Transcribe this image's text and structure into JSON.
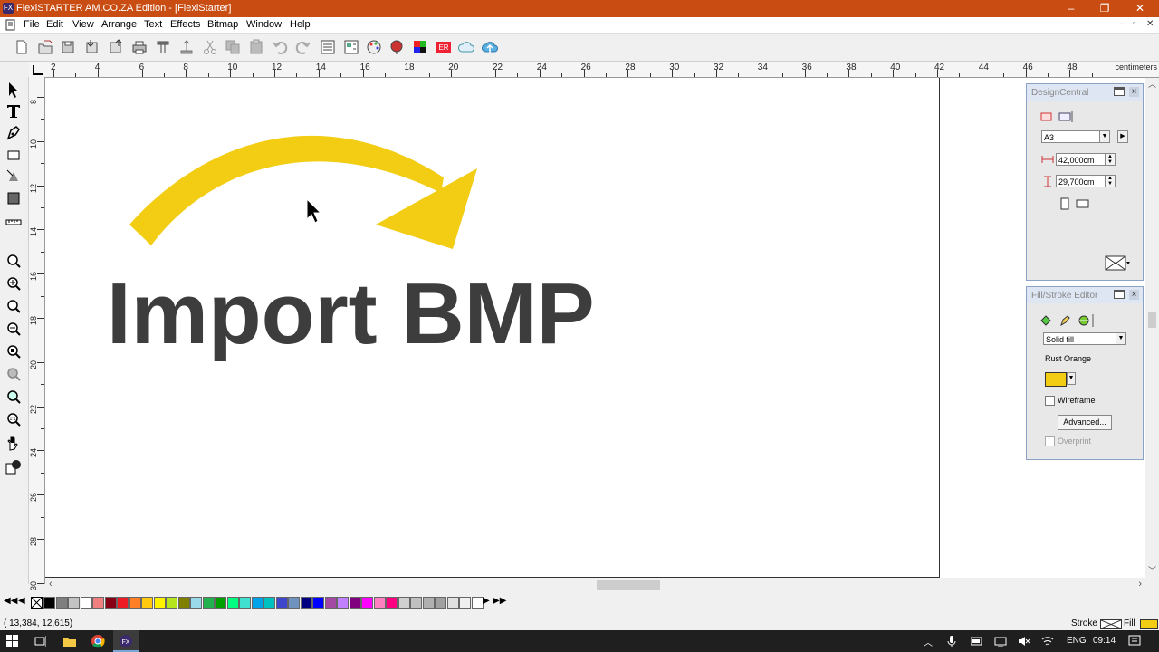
{
  "window": {
    "title": "FlexiSTARTER AM.CO.ZA Edition - [FlexiStarter]",
    "minimize": "–",
    "restore": "❐",
    "close": "✕"
  },
  "menu": [
    "File",
    "Edit",
    "View",
    "Arrange",
    "Text",
    "Effects",
    "Bitmap",
    "Window",
    "Help"
  ],
  "mdi_controls": [
    "–",
    "▫",
    "✕"
  ],
  "ruler": {
    "unit": "centimeters",
    "h_labels": [
      "2",
      "4",
      "6",
      "8",
      "10",
      "12",
      "14",
      "16",
      "18",
      "20",
      "22",
      "24",
      "26",
      "28",
      "30",
      "32",
      "34",
      "36",
      "38",
      "40",
      "42",
      "44",
      "46",
      "48"
    ],
    "v_labels": [
      "8",
      "10",
      "12",
      "14",
      "16",
      "18",
      "20",
      "22",
      "24",
      "26",
      "28",
      "30"
    ]
  },
  "canvas": {
    "text": "Import BMP",
    "arrow_color": "#f2cd13",
    "text_color": "#3d3d3d"
  },
  "design_central": {
    "title": "DesignCentral",
    "page_size": "A3",
    "width": "42,000cm",
    "height": "29,700cm"
  },
  "fill_stroke": {
    "title": "Fill/Stroke Editor",
    "fill_type": "Solid fill",
    "color_name": "Rust Orange",
    "swatch_color": "#f2cd13",
    "wireframe": "Wireframe",
    "advanced": "Advanced...",
    "overprint": "Overprint"
  },
  "palette_colors": [
    "#000000",
    "#7f7f7f",
    "#c3c3c3",
    "#ffffff",
    "#f08080",
    "#880015",
    "#ed1c24",
    "#ff7f27",
    "#ffc90e",
    "#fff200",
    "#b5e61d",
    "#808000",
    "#99d9ea",
    "#22b14c",
    "#00a000",
    "#00ff80",
    "#40e0d0",
    "#00a2e8",
    "#00c0c0",
    "#3f48cc",
    "#7092be",
    "#000080",
    "#0000ff",
    "#a349a4",
    "#c080ff",
    "#800080",
    "#ff00ff",
    "#ff80c0",
    "#ff0080",
    "#d0d0d0",
    "#c0c0c0",
    "#b0b0b0",
    "#a0a0a0",
    "#e0e0e0",
    "#f0f0f0",
    "#ffffff"
  ],
  "status": {
    "coords": "(   13,384,    12,615)",
    "stroke_label": "Stroke",
    "fill_label": "Fill",
    "fill_color": "#f2cd13"
  },
  "taskbar": {
    "lang": "ENG",
    "time": "09:14"
  }
}
